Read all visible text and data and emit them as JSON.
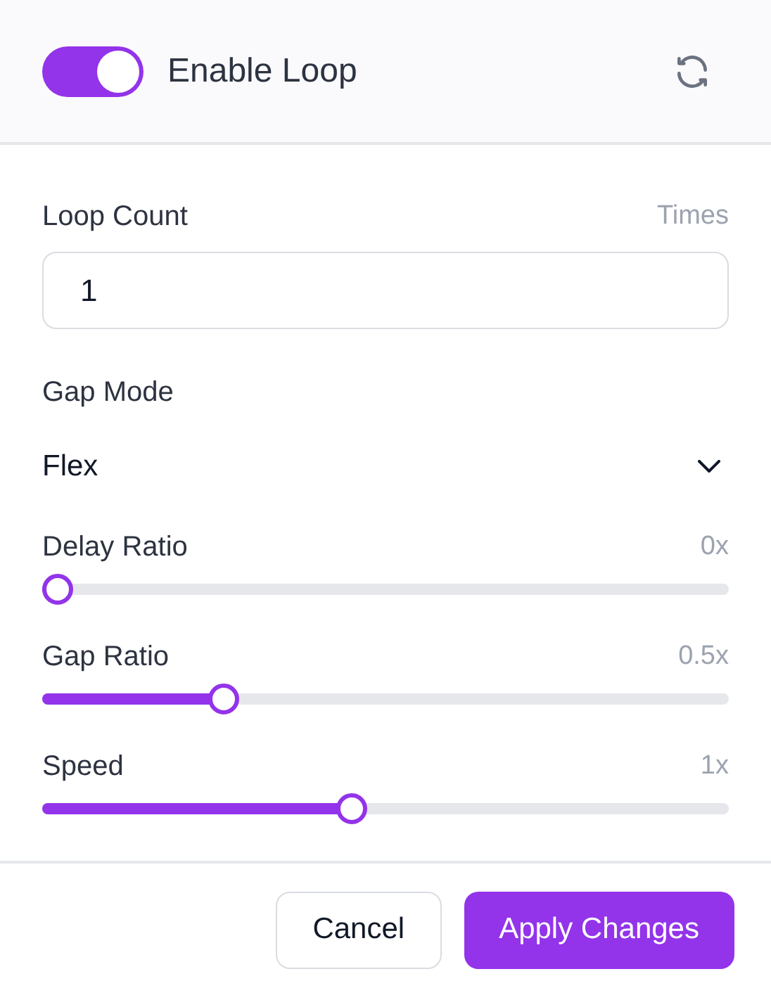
{
  "header": {
    "toggle": {
      "label": "Enable Loop",
      "on": true
    }
  },
  "loop_count": {
    "label": "Loop Count",
    "unit": "Times",
    "value": "1"
  },
  "gap_mode": {
    "label": "Gap Mode",
    "value": "Flex"
  },
  "sliders": [
    {
      "label": "Delay Ratio",
      "reading": "0x",
      "level": 0
    },
    {
      "label": "Gap Ratio",
      "reading": "0.5x",
      "level": 0.25
    },
    {
      "label": "Speed",
      "reading": "1x",
      "level": 0.445
    }
  ],
  "buttons": [
    {
      "label": "Cancel",
      "kind": "secondary"
    },
    {
      "label": "Apply Changes",
      "kind": "primary"
    }
  ]
}
